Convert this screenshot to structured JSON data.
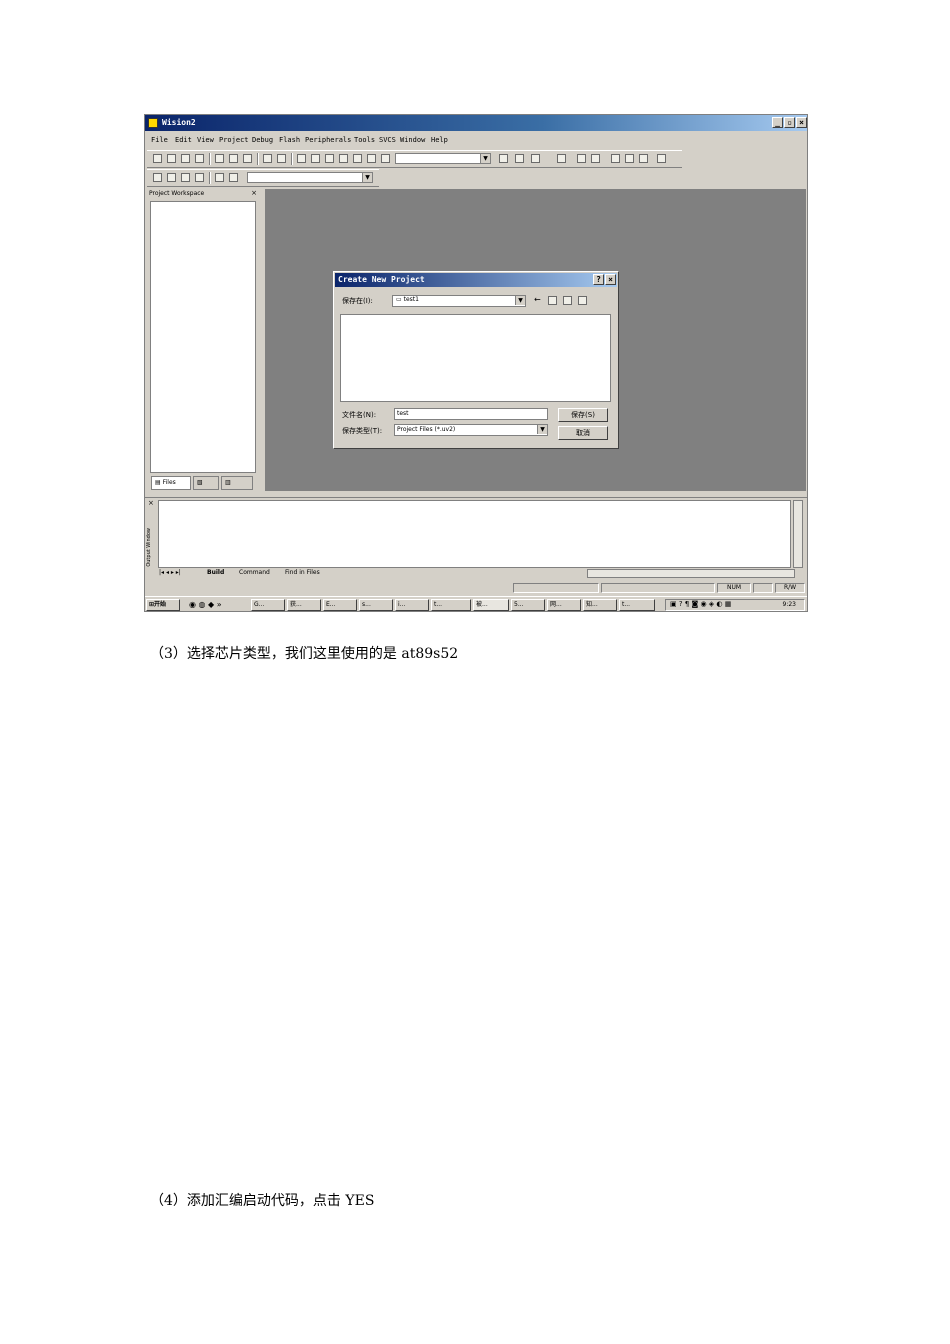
{
  "window": {
    "title": "Wision2",
    "menu": [
      "File",
      "Edit",
      "View",
      "Project",
      "Debug",
      "Flash",
      "Peripherals",
      "Tools",
      "SVCS",
      "Window",
      "Help"
    ],
    "workspace_title": "Project Workspace",
    "workspace_tabs": [
      "Files",
      "",
      ""
    ]
  },
  "dialog": {
    "title": "Create New Project",
    "save_in_label": "保存在(I):",
    "save_in_value": "test1",
    "filename_label": "文件名(N):",
    "filename_value": "test",
    "filetype_label": "保存类型(T):",
    "filetype_value": "Project Files (*.uv2)",
    "save_button": "保存(S)",
    "cancel_button": "取消"
  },
  "output": {
    "side_label": "Output Window",
    "tabs": [
      "Build",
      "Command",
      "Find in Files"
    ]
  },
  "status": {
    "cells": [
      "NUM",
      "R/W"
    ]
  },
  "taskbar": {
    "start": "开始",
    "items": [
      "G...",
      "获...",
      "E...",
      "s...",
      "i...",
      "t...",
      "被...",
      "5...",
      "网...",
      "知...",
      "t..."
    ],
    "clock": "9:23"
  },
  "captions": {
    "step3": "（3）选择芯片类型，我们这里使用的是 at89s52",
    "step4": "（4）添加汇编启动代码，点击 YES"
  }
}
